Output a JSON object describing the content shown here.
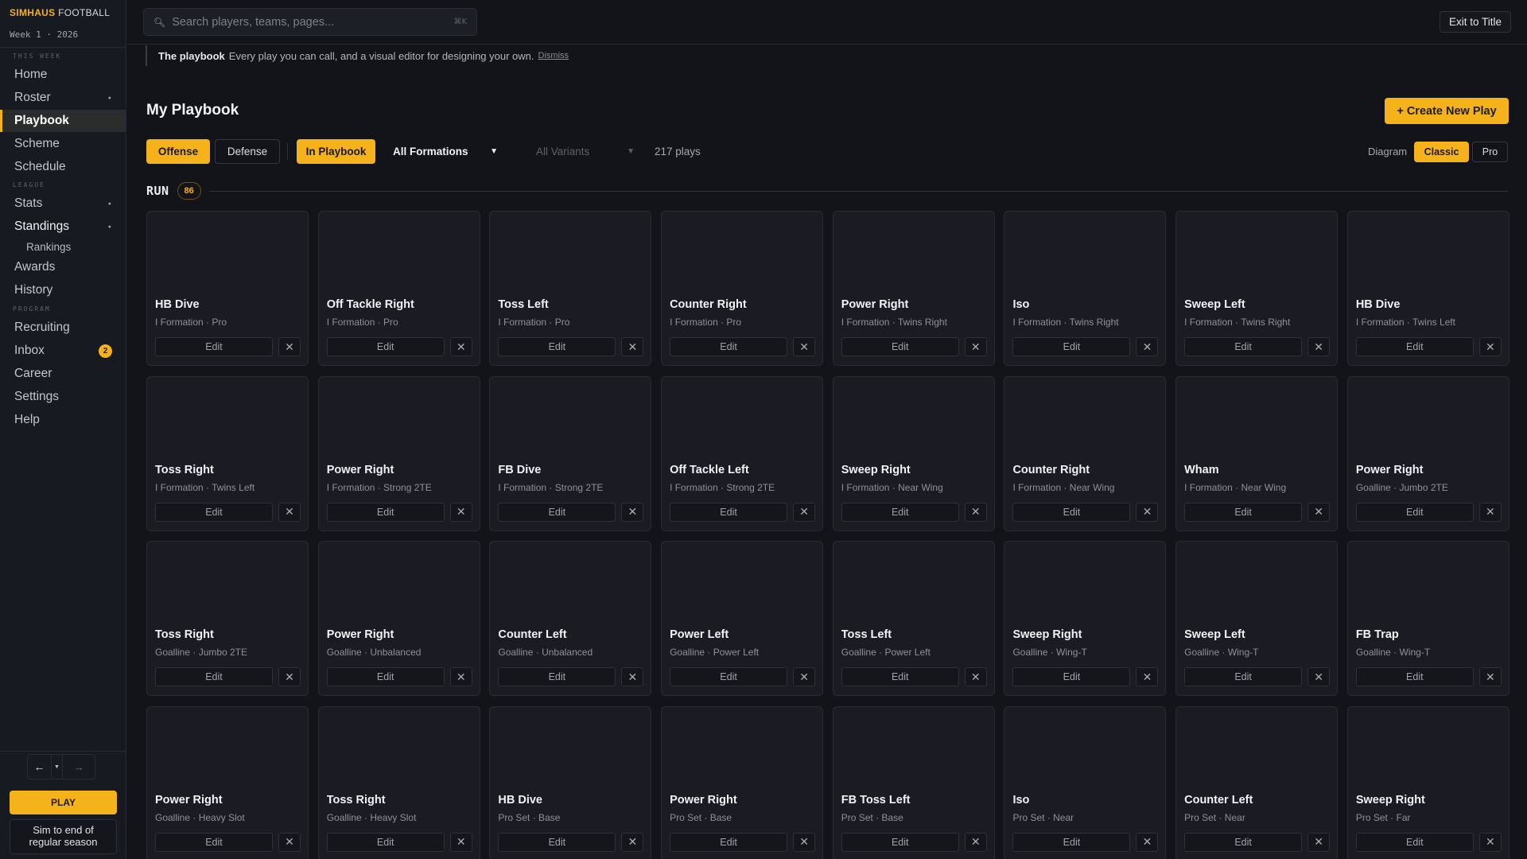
{
  "brand": {
    "part1": "SIMHAUS",
    "part2": "FOOTBALL"
  },
  "season_label": "Week 1 · 2026",
  "sidebar": {
    "section_this_week": "THIS WEEK",
    "section_league": "LEAGUE",
    "section_program": "PROGRAM",
    "items": {
      "home": "Home",
      "roster": "Roster",
      "playbook": "Playbook",
      "scheme": "Scheme",
      "schedule": "Schedule",
      "stats": "Stats",
      "standings": "Standings",
      "rankings": "Rankings",
      "awards": "Awards",
      "history": "History",
      "recruiting": "Recruiting",
      "inbox": "Inbox",
      "career": "Career",
      "settings": "Settings",
      "help": "Help"
    },
    "inbox_badge": "2",
    "active_item": "Playbook",
    "play_label": "PLAY",
    "sim_label": "Sim to end of regular season"
  },
  "topbar": {
    "search_placeholder": "Search players, teams, pages...",
    "search_shortcut": "⌘K",
    "exit_label": "Exit to Title"
  },
  "info": {
    "title": "The playbook",
    "text": "Every play you can call, and a visual editor for designing your own.",
    "dismiss": "Dismiss"
  },
  "page": {
    "title": "My Playbook",
    "create_label": "+ Create New Play"
  },
  "filters": {
    "offense": "Offense",
    "defense": "Defense",
    "in_playbook": "In Playbook",
    "formation": "All Formations",
    "variant": "All Variants",
    "count": "217 plays",
    "diagram_label": "Diagram",
    "classic": "Classic",
    "pro": "Pro"
  },
  "section": {
    "title": "RUN",
    "count": "86"
  },
  "card_actions": {
    "edit": "Edit",
    "remove_icon": "close-icon"
  },
  "plays": [
    {
      "name": "HB Dive",
      "sub": "I Formation · Pro"
    },
    {
      "name": "Off Tackle Right",
      "sub": "I Formation · Pro"
    },
    {
      "name": "Toss Left",
      "sub": "I Formation · Pro"
    },
    {
      "name": "Counter Right",
      "sub": "I Formation · Pro"
    },
    {
      "name": "Power Right",
      "sub": "I Formation · Twins Right"
    },
    {
      "name": "Iso",
      "sub": "I Formation · Twins Right"
    },
    {
      "name": "Sweep Left",
      "sub": "I Formation · Twins Right"
    },
    {
      "name": "HB Dive",
      "sub": "I Formation · Twins Left"
    },
    {
      "name": "Toss Right",
      "sub": "I Formation · Twins Left"
    },
    {
      "name": "Power Right",
      "sub": "I Formation · Strong 2TE"
    },
    {
      "name": "FB Dive",
      "sub": "I Formation · Strong 2TE"
    },
    {
      "name": "Off Tackle Left",
      "sub": "I Formation · Strong 2TE"
    },
    {
      "name": "Sweep Right",
      "sub": "I Formation · Near Wing"
    },
    {
      "name": "Counter Right",
      "sub": "I Formation · Near Wing"
    },
    {
      "name": "Wham",
      "sub": "I Formation · Near Wing"
    },
    {
      "name": "Power Right",
      "sub": "Goalline · Jumbo 2TE"
    },
    {
      "name": "Toss Right",
      "sub": "Goalline · Jumbo 2TE"
    },
    {
      "name": "Power Right",
      "sub": "Goalline · Unbalanced"
    },
    {
      "name": "Counter Left",
      "sub": "Goalline · Unbalanced"
    },
    {
      "name": "Power Left",
      "sub": "Goalline · Power Left"
    },
    {
      "name": "Toss Left",
      "sub": "Goalline · Power Left"
    },
    {
      "name": "Sweep Right",
      "sub": "Goalline · Wing-T"
    },
    {
      "name": "Sweep Left",
      "sub": "Goalline · Wing-T"
    },
    {
      "name": "FB Trap",
      "sub": "Goalline · Wing-T"
    },
    {
      "name": "Power Right",
      "sub": "Goalline · Heavy Slot"
    },
    {
      "name": "Toss Right",
      "sub": "Goalline · Heavy Slot"
    },
    {
      "name": "HB Dive",
      "sub": "Pro Set · Base"
    },
    {
      "name": "Power Right",
      "sub": "Pro Set · Base"
    },
    {
      "name": "FB Toss Left",
      "sub": "Pro Set · Base"
    },
    {
      "name": "Iso",
      "sub": "Pro Set · Near"
    },
    {
      "name": "Counter Left",
      "sub": "Pro Set · Near"
    },
    {
      "name": "Sweep Right",
      "sub": "Pro Set · Far"
    }
  ],
  "colors": {
    "accent": "#f5b21b",
    "background": "#131419",
    "card": "#1b1c23"
  }
}
